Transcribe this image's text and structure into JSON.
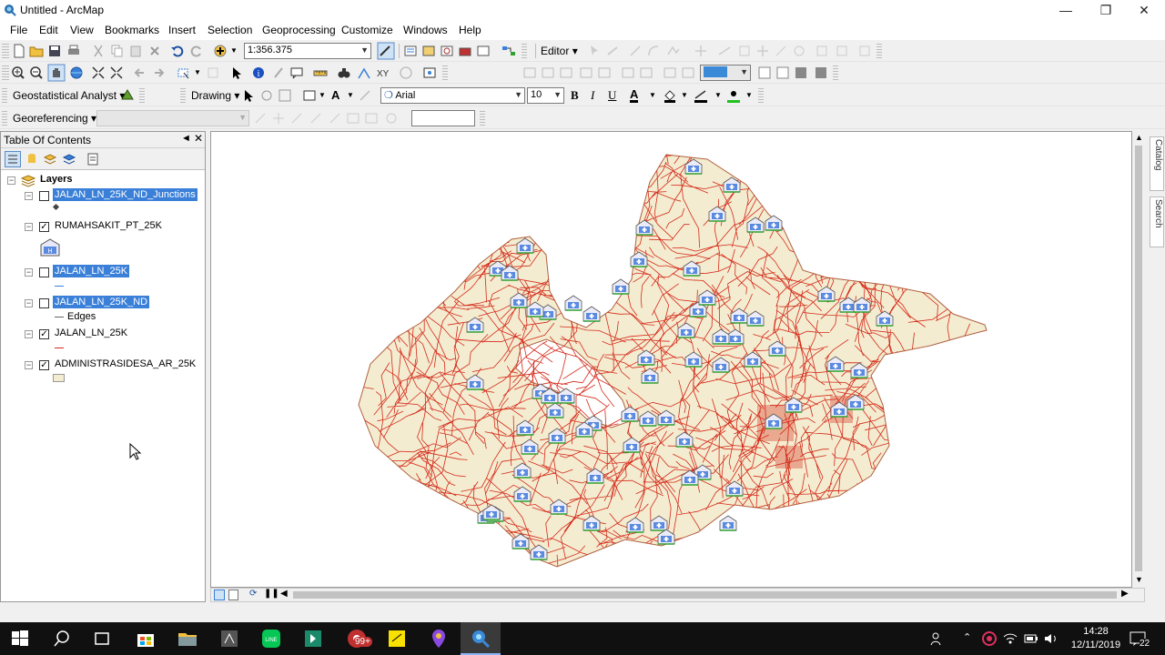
{
  "window": {
    "title": "Untitled - ArcMap"
  },
  "menu": [
    "File",
    "Edit",
    "View",
    "Bookmarks",
    "Insert",
    "Selection",
    "Geoprocessing",
    "Customize",
    "Windows",
    "Help"
  ],
  "standard_toolbar": {
    "scale": "1:356.375",
    "editor_label": "Editor"
  },
  "geostat_toolbar": {
    "label": "Geostatistical Analyst",
    "drawing_label": "Drawing",
    "font": "Arial",
    "font_size": "10",
    "bold": "B",
    "italic": "I",
    "underline": "U",
    "text_tool": "A"
  },
  "georef_toolbar": {
    "label": "Georeferencing"
  },
  "toc": {
    "title": "Table Of Contents",
    "root": "Layers",
    "layers": [
      {
        "name": "JALAN_LN_25K_ND_Junctions",
        "checked": false,
        "selected": true
      },
      {
        "name": "RUMAHSAKIT_PT_25K",
        "checked": true,
        "selected": false
      },
      {
        "name": "JALAN_LN_25K",
        "checked": false,
        "selected": true
      },
      {
        "name": "JALAN_LN_25K_ND",
        "checked": false,
        "selected": true,
        "sublabel": "Edges"
      },
      {
        "name": "JALAN_LN_25K",
        "checked": true,
        "selected": false
      },
      {
        "name": "ADMINISTRASIDESA_AR_25K",
        "checked": true,
        "selected": false
      }
    ]
  },
  "side_tabs": [
    "Catalog",
    "Search"
  ],
  "taskbar": {
    "time": "14:28",
    "date": "12/11/2019",
    "badge": "99+",
    "notifications": "22"
  },
  "colors": {
    "road": "#d42a1a",
    "admin_fill": "#f4ecd0",
    "admin_border": "#b06040",
    "selection": "#3a7fd8"
  }
}
